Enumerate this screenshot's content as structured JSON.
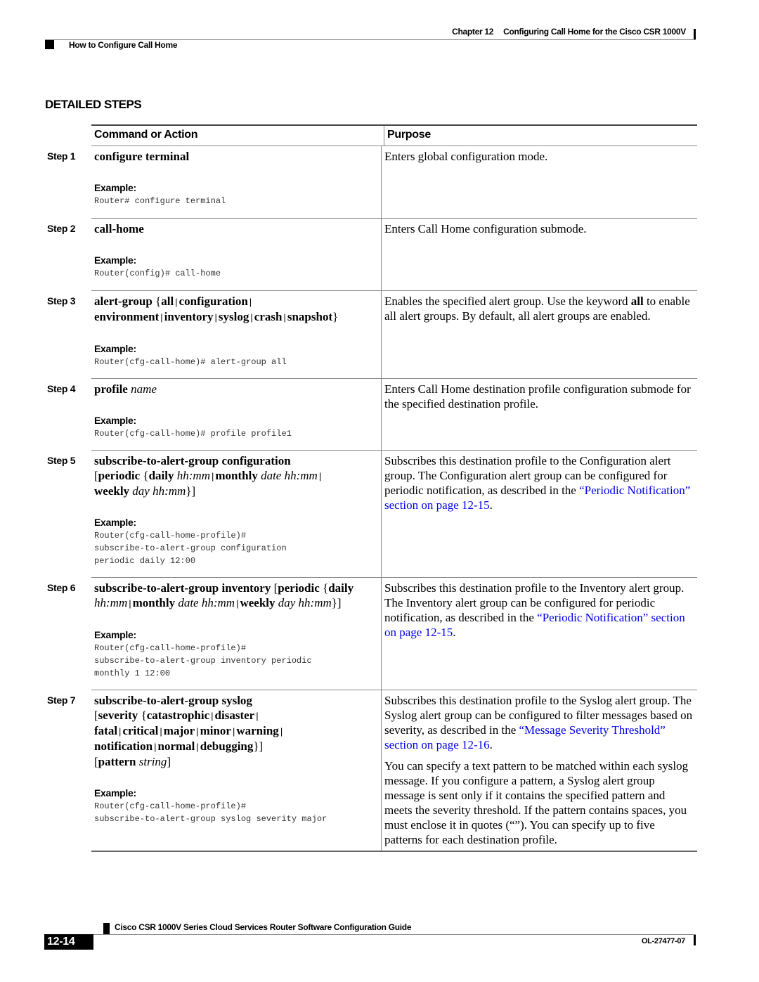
{
  "header": {
    "chapter_number": "Chapter 12",
    "chapter_title": "Configuring Call Home for the Cisco CSR 1000V",
    "section": "How to Configure Call Home"
  },
  "section_title": "DETAILED STEPS",
  "table": {
    "columns": [
      "Command or Action",
      "Purpose"
    ],
    "example_label": "Example:",
    "steps": [
      {
        "label": "Step 1",
        "command": "configure terminal",
        "example": "Router# configure terminal",
        "purpose": [
          "Enters global configuration mode."
        ]
      },
      {
        "label": "Step 2",
        "command": "call-home",
        "example": "Router(config)# call-home",
        "purpose": [
          "Enters Call Home configuration submode."
        ]
      },
      {
        "label": "Step 3",
        "command": "alert-group {all | configuration | environment | inventory | syslog | crash | snapshot}",
        "command_parts": {
          "kw": "alert-group",
          "all": "all",
          "configuration": "configuration",
          "environment": "environment",
          "inventory": "inventory",
          "syslog": "syslog",
          "crash": "crash",
          "snapshot": "snapshot"
        },
        "example": "Router(cfg-call-home)# alert-group all",
        "purpose_parts": {
          "before": "Enables the specified alert group. Use the keyword ",
          "keyword": "all",
          "after": " to enable all alert groups. By default, all alert groups are enabled."
        }
      },
      {
        "label": "Step 4",
        "command": "profile name",
        "command_parts": {
          "kw": "profile",
          "arg": "name"
        },
        "example": "Router(cfg-call-home)# profile profile1",
        "purpose": [
          "Enters Call Home destination profile configuration submode for the specified destination profile."
        ]
      },
      {
        "label": "Step 5",
        "command": "subscribe-to-alert-group configuration [periodic {daily hh:mm | monthly date hh:mm | weekly day hh:mm}]",
        "command_parts": {
          "kw": "subscribe-to-alert-group configuration",
          "periodic": "periodic",
          "daily": "daily",
          "hhmm": "hh:mm",
          "monthly": "monthly",
          "date_hhmm": "date hh:mm",
          "weekly": "weekly",
          "day_hhmm": "day hh:mm"
        },
        "example": "Router(cfg-call-home-profile)#\nsubscribe-to-alert-group configuration\nperiodic daily 12:00",
        "purpose_parts": {
          "before": "Subscribes this destination profile to the Configuration alert group. The Configuration alert group can be configured for periodic notification, as described in the ",
          "link": "“Periodic Notification” section on page 12-15",
          "after": "."
        }
      },
      {
        "label": "Step 6",
        "command": "subscribe-to-alert-group inventory [periodic {daily hh:mm | monthly date hh:mm | weekly day hh:mm}]",
        "command_parts": {
          "kw": "subscribe-to-alert-group inventory",
          "periodic": "periodic",
          "daily": "daily",
          "hhmm": "hh:mm",
          "monthly": "monthly",
          "date_hhmm": "date hh:mm",
          "weekly": "weekly",
          "day_hhmm": "day hh:mm"
        },
        "example": "Router(cfg-call-home-profile)#\nsubscribe-to-alert-group inventory periodic\nmonthly 1 12:00",
        "purpose_parts": {
          "before": "Subscribes this destination profile to the Inventory alert group. The Inventory alert group can be configured for periodic notification, as described in the ",
          "link": "“Periodic Notification” section on page 12-15",
          "after": "."
        }
      },
      {
        "label": "Step 7",
        "command": "subscribe-to-alert-group syslog [severity {catastrophic | disaster | fatal | critical | major | minor | warning | notification | normal | debugging}] [pattern string]",
        "command_parts": {
          "kw": "subscribe-to-alert-group syslog",
          "severity": "severity",
          "catastrophic": "catastrophic",
          "disaster": "disaster",
          "fatal": "fatal",
          "critical": "critical",
          "major": "major",
          "minor": "minor",
          "warning": "warning",
          "notification": "notification",
          "normal": "normal",
          "debugging": "debugging",
          "pattern": "pattern",
          "string": "string"
        },
        "example": "Router(cfg-call-home-profile)#\nsubscribe-to-alert-group syslog severity major",
        "purpose_parts": {
          "before": "Subscribes this destination profile to the Syslog alert group. The Syslog alert group can be configured to filter messages based on severity, as described in the ",
          "link": "“Message Severity Threshold” section on page 12-16",
          "after": ".",
          "second_paragraph": "You can specify a text pattern to be matched within each syslog message. If you configure a pattern, a Syslog alert group message is sent only if it contains the specified pattern and meets the severity threshold. If the pattern contains spaces, you must enclose it in quotes (“”). You can specify up to five patterns for each destination profile."
        }
      }
    ]
  },
  "footer": {
    "guide_title": "Cisco CSR 1000V Series Cloud Services Router Software Configuration Guide",
    "page_number": "12-14",
    "doc_id": "OL-27477-07"
  },
  "colors": {
    "link": "#0000ee",
    "rule": "#888888",
    "text": "#000000"
  }
}
